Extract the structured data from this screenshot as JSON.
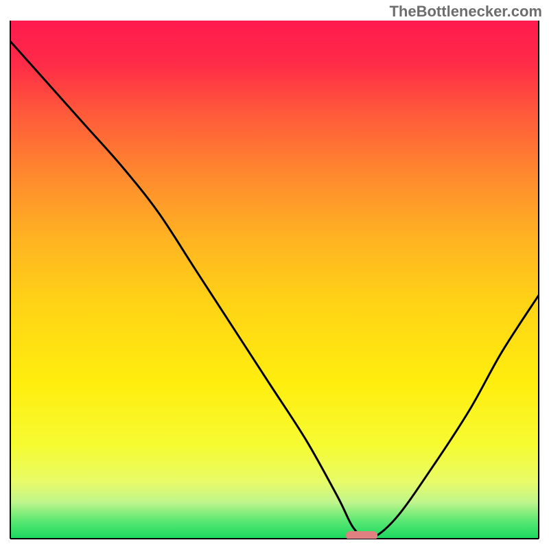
{
  "watermark": "TheBottlenecker.com",
  "chart_data": {
    "type": "line",
    "title": "",
    "xlabel": "",
    "ylabel": "",
    "xlim": [
      0,
      100
    ],
    "ylim": [
      0,
      100
    ],
    "grid": false,
    "background": "gradient-red-yellow-green",
    "x": [
      0,
      7,
      14,
      21,
      28,
      35,
      42,
      49,
      56,
      62,
      65,
      68,
      73,
      80,
      87,
      93,
      100
    ],
    "values": [
      96,
      88,
      80,
      72,
      63,
      52,
      41,
      30,
      19,
      8,
      2,
      0,
      4,
      14,
      25,
      36,
      47
    ],
    "series_color": "#000000",
    "marker": {
      "x": 66.5,
      "y": 0,
      "shape": "rounded-bar",
      "color": "#e08080"
    }
  }
}
